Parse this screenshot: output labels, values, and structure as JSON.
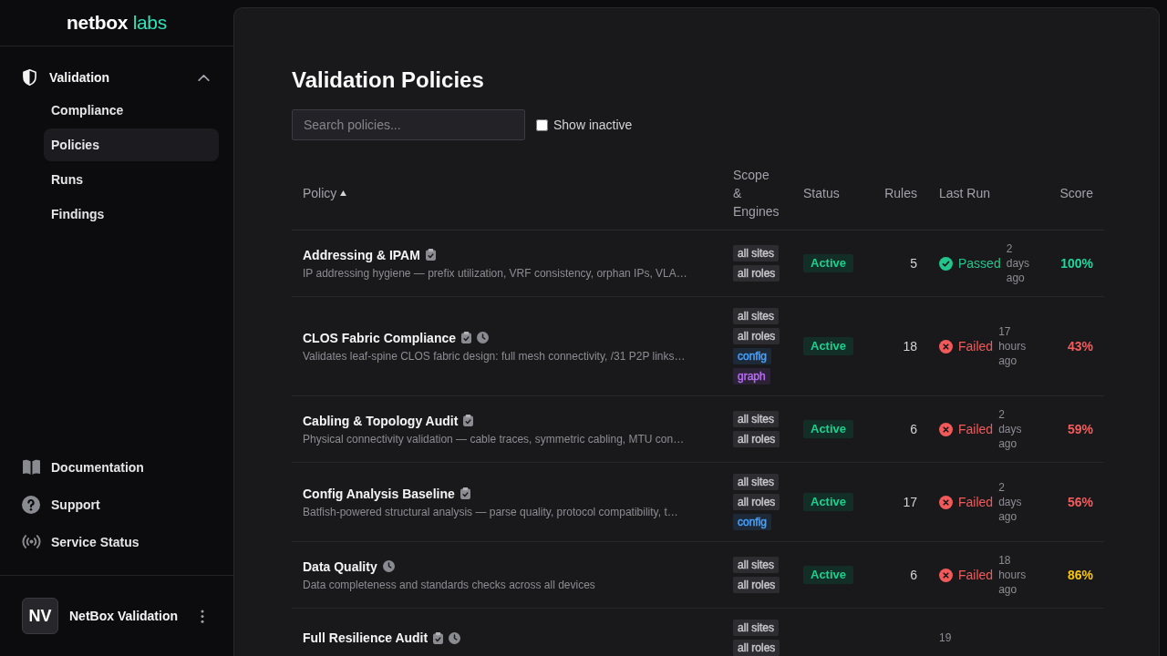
{
  "sidebar": {
    "logo": {
      "part_1": "netbox",
      "part_2": "labs"
    },
    "nav": [
      {
        "label": "Validation",
        "expanded": true,
        "children": [
          {
            "label": "Compliance",
            "selected": false
          },
          {
            "label": "Policies",
            "selected": true
          },
          {
            "label": "Runs",
            "selected": false
          },
          {
            "label": "Findings",
            "selected": false
          }
        ]
      }
    ],
    "links": [
      {
        "label": "Documentation",
        "kind": "docs"
      },
      {
        "label": "Support",
        "kind": "support"
      },
      {
        "label": "Service Status",
        "kind": "status"
      }
    ],
    "user": {
      "initials": "NV",
      "name": "NetBox Validation"
    }
  },
  "page": {
    "title": "Validation Policies",
    "search": {
      "placeholder": "Search policies..."
    },
    "show_inactive": {
      "label": "Show inactive",
      "checked": false
    }
  },
  "table": {
    "columns": [
      {
        "label": "Policy",
        "sorted": true
      },
      {
        "label": "Scope & Engines",
        "sorted": false
      },
      {
        "label": "Status",
        "sorted": false
      },
      {
        "label": "Rules",
        "sorted": false
      },
      {
        "label": "Last Run",
        "sorted": false
      },
      {
        "label": "Score",
        "sorted": false
      }
    ],
    "rows": [
      {
        "name": "Addressing & IPAM",
        "checklist": true,
        "scheduled": false,
        "description": "IP addressing hygiene — prefix utilization, VRF consistency, orphan IPs, VLA…",
        "tags": [
          {
            "label": "all sites",
            "color": "#c8c8cc"
          },
          {
            "label": "all roles",
            "color": "#c8c8cc"
          }
        ],
        "status": {
          "label": "Active",
          "kind": "active"
        },
        "rules": "5",
        "last_run": {
          "passed": true,
          "label": "Passed",
          "time": "2 days ago"
        },
        "score": {
          "value": "100%",
          "color": "#1fd69c"
        }
      },
      {
        "name": "CLOS Fabric Compliance",
        "checklist": true,
        "scheduled": true,
        "description": "Validates leaf-spine CLOS fabric design: full mesh connectivity, /31 P2P links…",
        "tags": [
          {
            "label": "all sites",
            "color": "#c8c8cc"
          },
          {
            "label": "all roles",
            "color": "#c8c8cc"
          },
          {
            "label": "config",
            "color": "#47a3ff"
          },
          {
            "label": "graph",
            "color": "#b86cf5"
          }
        ],
        "status": {
          "label": "Active",
          "kind": "active"
        },
        "rules": "18",
        "last_run": {
          "passed": false,
          "label": "Failed",
          "time": "17 hours ago"
        },
        "score": {
          "value": "43%",
          "color": "#f35c5c"
        }
      },
      {
        "name": "Cabling & Topology Audit",
        "checklist": true,
        "scheduled": false,
        "description": "Physical connectivity validation — cable traces, symmetric cabling, MTU con…",
        "tags": [
          {
            "label": "all sites",
            "color": "#c8c8cc"
          },
          {
            "label": "all roles",
            "color": "#c8c8cc"
          }
        ],
        "status": {
          "label": "Active",
          "kind": "active"
        },
        "rules": "6",
        "last_run": {
          "passed": false,
          "label": "Failed",
          "time": "2 days ago"
        },
        "score": {
          "value": "59%",
          "color": "#f35c5c"
        }
      },
      {
        "name": "Config Analysis Baseline",
        "checklist": true,
        "scheduled": false,
        "description": "Batfish-powered structural analysis — parse quality, protocol compatibility, t…",
        "tags": [
          {
            "label": "all sites",
            "color": "#c8c8cc"
          },
          {
            "label": "all roles",
            "color": "#c8c8cc"
          },
          {
            "label": "config",
            "color": "#47a3ff"
          }
        ],
        "status": {
          "label": "Active",
          "kind": "active"
        },
        "rules": "17",
        "last_run": {
          "passed": false,
          "label": "Failed",
          "time": "2 days ago"
        },
        "score": {
          "value": "56%",
          "color": "#f35c5c"
        }
      },
      {
        "name": "Data Quality",
        "checklist": false,
        "scheduled": true,
        "description": "Data completeness and standards checks across all devices",
        "tags": [
          {
            "label": "all sites",
            "color": "#c8c8cc"
          },
          {
            "label": "all roles",
            "color": "#c8c8cc"
          }
        ],
        "status": {
          "label": "Active",
          "kind": "active"
        },
        "rules": "6",
        "last_run": {
          "passed": false,
          "label": "Failed",
          "time": "18 hours ago"
        },
        "score": {
          "value": "86%",
          "color": "#f8c513"
        }
      },
      {
        "name": "Full Resilience Audit",
        "checklist": true,
        "scheduled": true,
        "tags": [
          {
            "label": "all sites",
            "color": "#c8c8cc"
          },
          {
            "label": "all roles",
            "color": "#c8c8cc"
          }
        ],
        "last_run": {
          "time": "19"
        }
      }
    ]
  }
}
